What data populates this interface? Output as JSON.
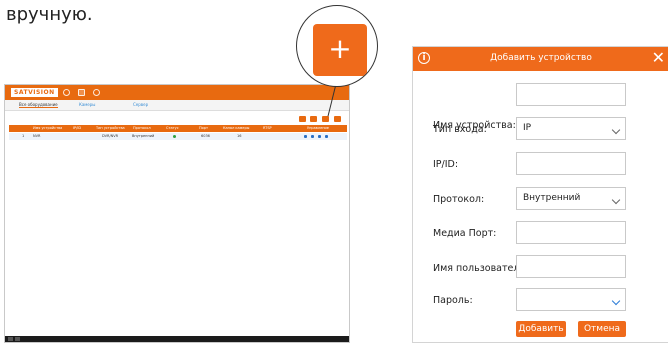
{
  "intro_text": "вручную.",
  "colors": {
    "accent": "#ef6a1b",
    "header_orange": "#e86a10",
    "link_blue": "#3b8fd6"
  },
  "screenshot": {
    "logo": "SATVISION",
    "tabs": [
      "Все оборудование",
      "Камеры",
      "Сервер"
    ],
    "columns": [
      "Имя устройства",
      "IP/ID",
      "Тип устройства",
      "Протокол",
      "Статус",
      "Порт",
      "Канал камеры",
      "RTSP",
      "Управление"
    ],
    "row": {
      "index": "1",
      "name": "NVR",
      "type": "DVR/NVR",
      "protocol": "Внутренний",
      "port": "6036",
      "channels": "16"
    }
  },
  "zoom": {
    "button_icon": "plus-icon"
  },
  "dialog": {
    "title": "Добавить устройство",
    "info_icon": "info-icon",
    "close_icon": "close-icon",
    "fields": {
      "device_name": {
        "label": "Имя устройства:",
        "value": ""
      },
      "input_type": {
        "label": "Тип входа:",
        "value": "IP"
      },
      "ip_id": {
        "label": "IP/ID:",
        "value": ""
      },
      "protocol": {
        "label": "Протокол:",
        "value": "Внутренний"
      },
      "media_port": {
        "label": "Медиа Порт:",
        "value": ""
      },
      "username": {
        "label": "Имя пользователя:",
        "value": ""
      },
      "password": {
        "label": "Пароль:",
        "value": ""
      }
    },
    "add_label": "Добавить",
    "cancel_label": "Отмена"
  }
}
